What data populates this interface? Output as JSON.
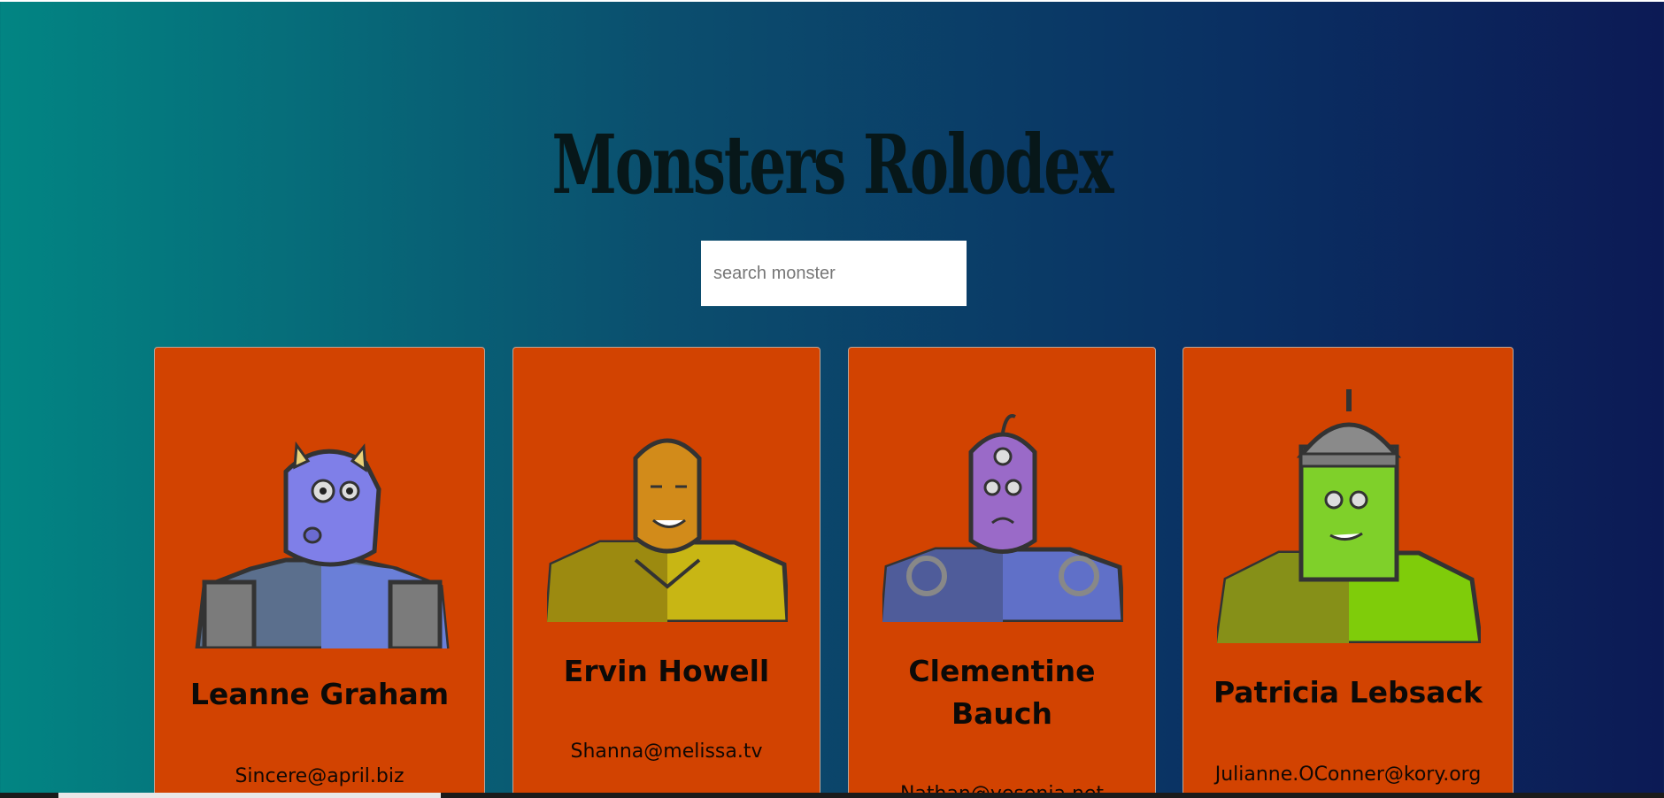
{
  "page": {
    "title": "Monsters Rolodex"
  },
  "search": {
    "placeholder": "search monster",
    "value": ""
  },
  "monsters": [
    {
      "name": "Leanne Graham",
      "email": "Sincere@april.biz",
      "avatar": "purple-horned-monster"
    },
    {
      "name": "Ervin Howell",
      "email": "Shanna@melissa.tv",
      "avatar": "orange-spiky-monster"
    },
    {
      "name": "Clementine Bauch",
      "email": "Nathan@yesenia.net",
      "avatar": "cyclops-robot-monster"
    },
    {
      "name": "Patricia Lebsack",
      "email": "Julianne.OConner@kory.org",
      "avatar": "helmet-green-monster"
    }
  ],
  "colors": {
    "card": "#d24301",
    "gradient_start": "#028583",
    "gradient_end": "#0c1a55"
  }
}
